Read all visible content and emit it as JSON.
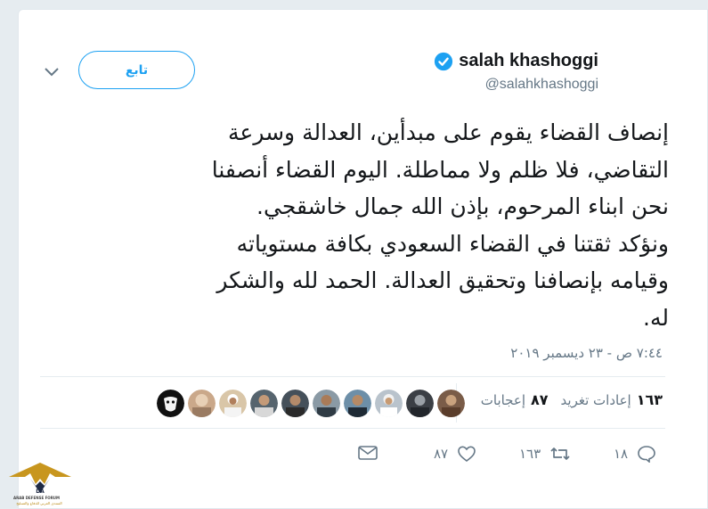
{
  "author": {
    "name": "salah khashoggi",
    "handle": "@salahkhashoggi",
    "verified": true
  },
  "follow_button": {
    "label": "تابع"
  },
  "tweet": {
    "lines": [
      "إنصاف القضاء يقوم على مبدأين، العدالة وسرعة",
      "التقاضي، فلا ظلم ولا مماطلة. اليوم القضاء أنصفنا",
      "نحن ابناء المرحوم، بإذن الله جمال خاشقجي.",
      "ونؤكد ثقتنا في القضاء السعودي بكافة مستوياته",
      "وقيامه بإنصافنا وتحقيق العدالة. الحمد لله والشكر",
      "له."
    ],
    "timestamp": "٧:٤٤ ص - ٢٣ ديسمبر ٢٠١٩"
  },
  "stats": {
    "retweets_count": "١٦٣",
    "retweets_label": "إعادات تغريد",
    "likes_count": "٨٧",
    "likes_label": "إعجابات"
  },
  "actions": {
    "replies": "١٨",
    "retweets": "١٦٣",
    "likes": "٨٧"
  },
  "colors": {
    "accent": "#1da1f2",
    "text": "#14171a",
    "muted": "#657786",
    "background": "#e6ecf0"
  },
  "watermark": {
    "title": "ARAB DEFENSE FORUM",
    "subtitle": "المنتدى العربي للدفاع والتسليح"
  }
}
